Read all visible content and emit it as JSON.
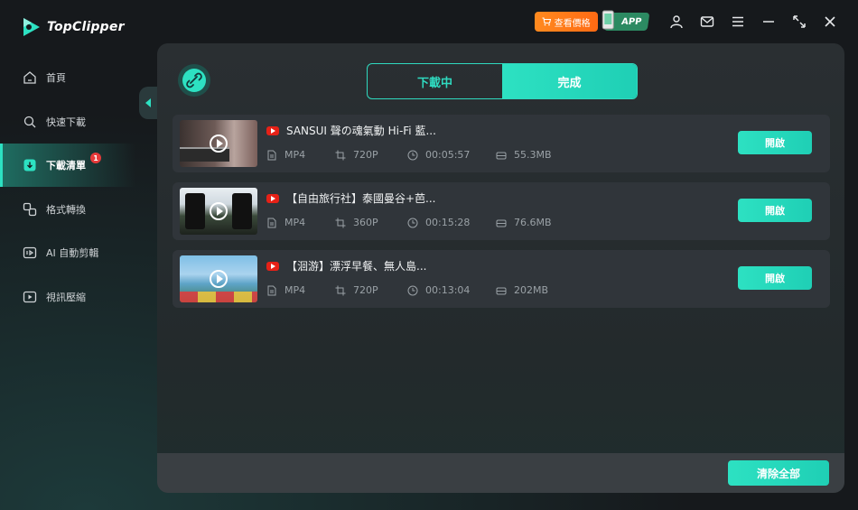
{
  "app": {
    "name": "TopClipper"
  },
  "topbar": {
    "price_label": "查看價格",
    "app_label": "APP"
  },
  "sidebar": {
    "items": [
      {
        "label": "首頁",
        "icon": "home-icon"
      },
      {
        "label": "快速下載",
        "icon": "search-icon"
      },
      {
        "label": "下載清單",
        "icon": "download-list-icon",
        "badge": "1"
      },
      {
        "label": "格式轉換",
        "icon": "convert-icon"
      },
      {
        "label": "AI 自動剪輯",
        "icon": "ai-edit-icon"
      },
      {
        "label": "視訊壓縮",
        "icon": "compress-icon"
      }
    ]
  },
  "tabs": [
    {
      "label": "下載中"
    },
    {
      "label": "完成"
    }
  ],
  "downloads": [
    {
      "title": "SANSUI 聲の魂氣動 Hi-Fi 藍...",
      "format": "MP4",
      "resolution": "720P",
      "duration": "00:05:57",
      "size": "55.3MB",
      "action": "開啟"
    },
    {
      "title": "【自由旅行社】泰國曼谷+芭...",
      "format": "MP4",
      "resolution": "360P",
      "duration": "00:15:28",
      "size": "76.6MB",
      "action": "開啟"
    },
    {
      "title": "【洄游】漂浮早餐、無人島...",
      "format": "MP4",
      "resolution": "720P",
      "duration": "00:13:04",
      "size": "202MB",
      "action": "開啟"
    }
  ],
  "footer": {
    "clear_all_label": "清除全部"
  },
  "colors": {
    "accent": "#2de1c2",
    "price_orange": "#ff7a1a",
    "badge_red": "#e63a3a",
    "youtube_red": "#e62117"
  }
}
